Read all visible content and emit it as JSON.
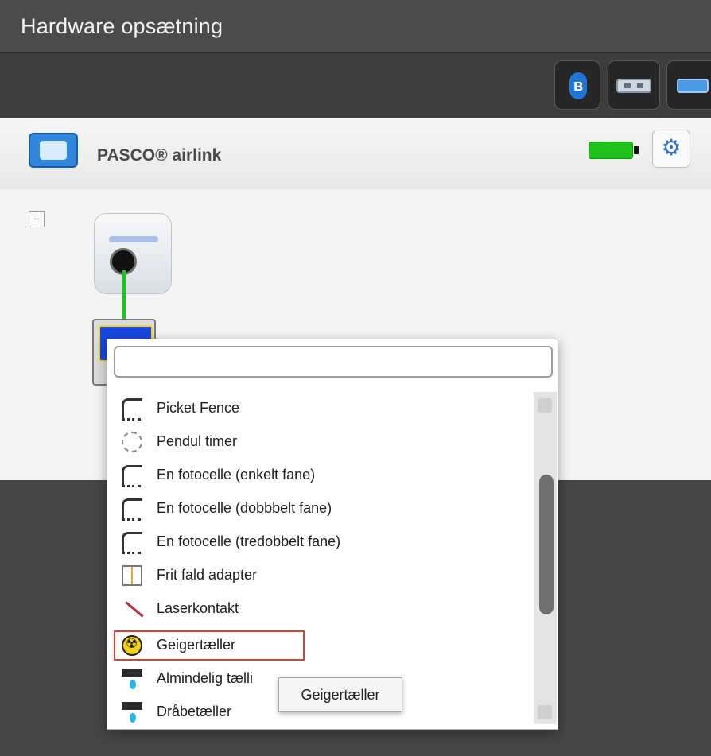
{
  "window": {
    "title": "Hardware opsætning"
  },
  "toolbar": {
    "buttons": [
      {
        "icon": "bluetooth-icon"
      },
      {
        "icon": "usb-icon"
      },
      {
        "icon": "cable-icon"
      }
    ]
  },
  "device": {
    "name": "PASCO® airlink",
    "battery": "full",
    "battery_color": "#1fc21b"
  },
  "dropdown": {
    "search_value": "",
    "items": [
      {
        "label": "Picket Fence",
        "icon": "photogate-icon"
      },
      {
        "label": "Pendul timer",
        "icon": "pendulum-icon"
      },
      {
        "label": "En fotocelle (enkelt fane)",
        "icon": "photogate-icon"
      },
      {
        "label": "En fotocelle (dobbbelt fane)",
        "icon": "photogate-icon"
      },
      {
        "label": "En fotocelle (tredobbelt fane)",
        "icon": "photogate-icon"
      },
      {
        "label": "Frit fald adapter",
        "icon": "freefall-adapter-icon"
      },
      {
        "label": "Laserkontakt",
        "icon": "laser-icon"
      },
      {
        "label": "Geigertæller",
        "icon": "geiger-icon"
      },
      {
        "label": "Almindelig tælli",
        "icon": "drop-counter-icon"
      },
      {
        "label": "Dråbetæller",
        "icon": "drop-counter-icon"
      }
    ],
    "selected_index": 7,
    "selected_outline_color": "#e43c2c",
    "tooltip": "Geigertæller"
  }
}
